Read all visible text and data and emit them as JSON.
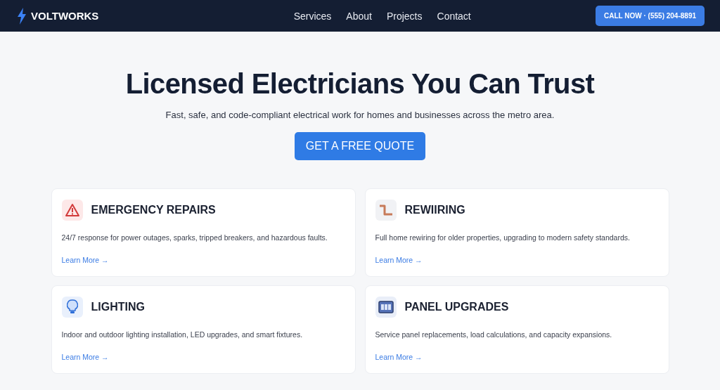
{
  "navbar": {
    "logo": "VOLTWORKS",
    "links": [
      "Services",
      "About",
      "Projects",
      "Contact"
    ],
    "cta": "CALL NOW · (555) 204-8891"
  },
  "hero": {
    "title": "Licensed Electricians You Can Trust",
    "subtitle": "Fast, safe, and code-compliant electrical work for homes and businesses across the metro area.",
    "button": "GET A FREE QUOTE"
  },
  "services": [
    {
      "title": "EMERGENCY REPAIRS",
      "description": "24/7 response for power outages, sparks, tripped breakers, and hazardous faults.",
      "link": "Learn More →"
    },
    {
      "title": "REWIIRING",
      "description": "Full home rewiring for older properties, upgrading to modern safety standards.",
      "link": "Learn More →"
    },
    {
      "title": "LIGHTING",
      "description": "Indoor and outdoor lighting installation, LED upgrades, and smart fixtures.",
      "link": "Learn More →"
    },
    {
      "title": "PANEL UPGRADES",
      "description": "Service panel replacements, load calculations, and capacity expansions.",
      "link": "Learn More →"
    }
  ]
}
